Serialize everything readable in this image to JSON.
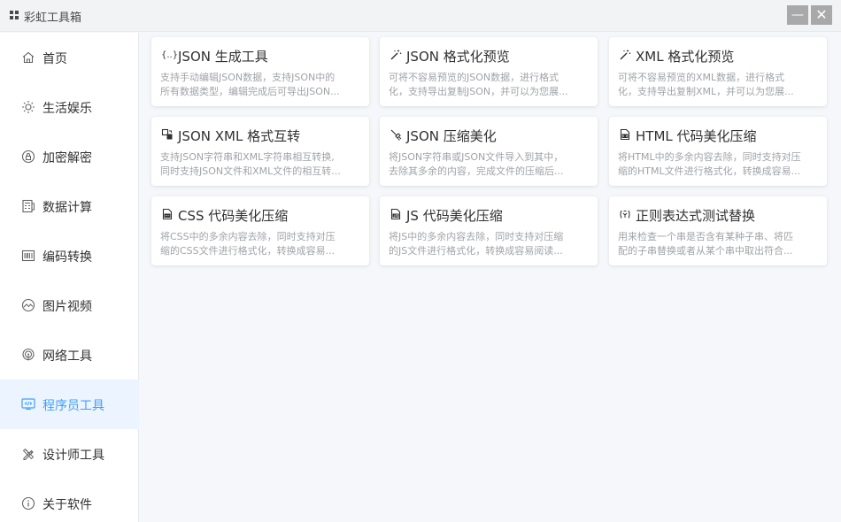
{
  "window": {
    "title": "彩虹工具箱",
    "minimize_glyph": "—",
    "close_glyph": "✕"
  },
  "sidebar": {
    "items": [
      {
        "label": "首页",
        "icon": "home-icon"
      },
      {
        "label": "生活娱乐",
        "icon": "sun-icon"
      },
      {
        "label": "加密解密",
        "icon": "lock-icon"
      },
      {
        "label": "数据计算",
        "icon": "calculator-icon"
      },
      {
        "label": "编码转换",
        "icon": "barcode-icon"
      },
      {
        "label": "图片视频",
        "icon": "image-icon"
      },
      {
        "label": "网络工具",
        "icon": "wifi-icon"
      },
      {
        "label": "程序员工具",
        "icon": "code-monitor-icon",
        "active": true
      },
      {
        "label": "设计师工具",
        "icon": "pencil-ruler-icon"
      },
      {
        "label": "关于软件",
        "icon": "info-icon"
      }
    ]
  },
  "tools": [
    {
      "title": "JSON 生成工具",
      "icon_text": "{..}",
      "desc1": "支持手动编辑JSON数据，支持JSON中的",
      "desc2": "所有数据类型，编辑完成后可导出JSON..."
    },
    {
      "title": "JSON 格式化预览",
      "icon": "magic-wand-icon",
      "desc1": "可将不容易预览的JSON数据，进行格式",
      "desc2": "化，支持导出复制JSON，并可以为您展..."
    },
    {
      "title": "XML 格式化预览",
      "icon": "magic-wand-icon",
      "desc1": "可将不容易预览的XML数据，进行格式",
      "desc2": "化，支持导出复制XML，并可以为您展..."
    },
    {
      "title": "JSON XML 格式互转",
      "icon": "convert-icon",
      "desc1": "支持JSON字符串和XML字符串相互转换,",
      "desc2": "同时支持JSON文件和XML文件的相互转..."
    },
    {
      "title": "JSON 压缩美化",
      "icon": "brush-icon",
      "desc1": "将JSON字符串或JSON文件导入到其中，",
      "desc2": "去除其多余的内容，完成文件的压缩后..."
    },
    {
      "title": "HTML 代码美化压缩",
      "icon": "file-code-icon",
      "desc1": "将HTML中的多余内容去除，同时支持对压",
      "desc2": "缩的HTML文件进行格式化，转换成容易..."
    },
    {
      "title": "CSS 代码美化压缩",
      "icon": "file-css-icon",
      "desc1": "将CSS中的多余内容去除，同时支持对压",
      "desc2": "缩的CSS文件进行格式化，转换成容易..."
    },
    {
      "title": "JS 代码美化压缩",
      "icon": "file-js-icon",
      "desc1": "将JS中的多余内容去除，同时支持对压缩",
      "desc2": "的JS文件进行格式化，转换成容易阅读..."
    },
    {
      "title": "正则表达式测试替换",
      "icon": "regex-icon",
      "desc1": "用来检查一个串是否含有某种子串、将匹",
      "desc2": "配的子串替换或者从某个串中取出符合..."
    }
  ],
  "colors": {
    "accent": "#409eff",
    "active_bg": "#ecf5ff",
    "text": "#303133",
    "muted": "#a0a3a8"
  }
}
